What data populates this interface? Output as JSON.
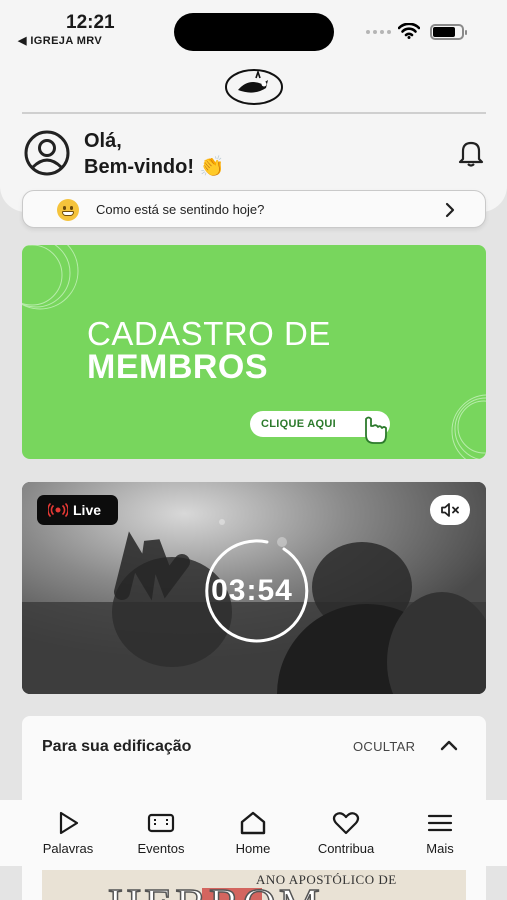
{
  "status_bar": {
    "time": "12:21",
    "back_app": "◀ IGREJA MRV"
  },
  "header": {
    "greeting_line1": "Olá,",
    "greeting_line2": "Bem-vindo!",
    "greeting_emoji": "👏"
  },
  "mood": {
    "prompt": "Como está se sentindo hoje?"
  },
  "banner": {
    "line1": "CADASTRO DE",
    "line2": "MEMBROS",
    "button": "CLIQUE AQUI",
    "color": "#78d65d"
  },
  "live": {
    "badge": "Live",
    "countdown": "03:54"
  },
  "edification": {
    "title": "Para sua edificação",
    "hide_label": "OCULTAR",
    "thumbnail_top": "ANO APOSTÓLICO DE",
    "thumbnail_big": "HEBROM"
  },
  "tabbar": {
    "items": [
      {
        "label": "Palavras",
        "icon": "play-icon"
      },
      {
        "label": "Eventos",
        "icon": "ticket-icon"
      },
      {
        "label": "Home",
        "icon": "home-icon"
      },
      {
        "label": "Contribua",
        "icon": "heart-icon"
      },
      {
        "label": "Mais",
        "icon": "menu-icon"
      }
    ]
  }
}
